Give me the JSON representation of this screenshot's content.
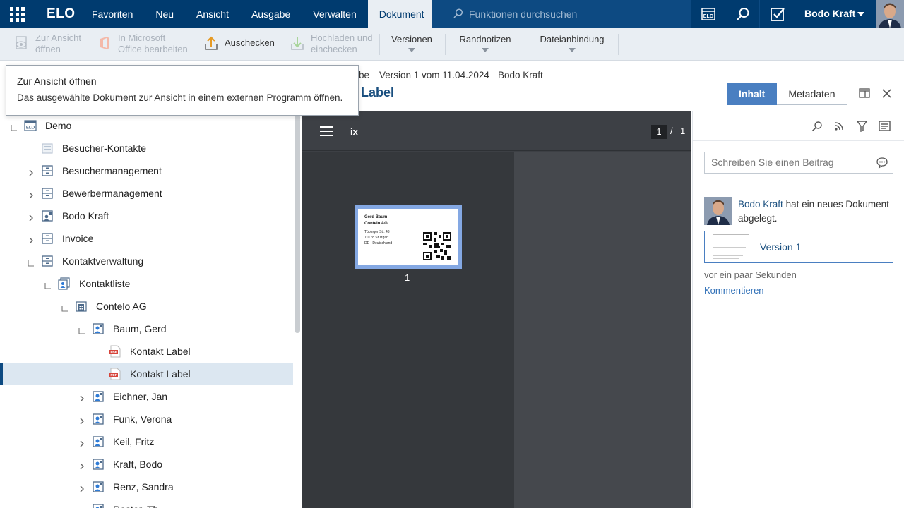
{
  "topbar": {
    "logo": "ELO",
    "nav": [
      "Favoriten",
      "Neu",
      "Ansicht",
      "Ausgabe",
      "Verwalten",
      "Dokument"
    ],
    "active_nav": "Dokument",
    "search_placeholder": "Funktionen durchsuchen",
    "user": "Bodo Kraft"
  },
  "ribbon": {
    "open_view": [
      "Zur Ansicht",
      "öffnen"
    ],
    "edit_office": [
      "In Microsoft",
      "Office bearbeiten"
    ],
    "checkout": "Auschecken",
    "upload": [
      "Hochladen und",
      "einchecken"
    ],
    "versions": "Versionen",
    "notes": "Randnotizen",
    "file_link": "Dateianbindung"
  },
  "tooltip": {
    "title": "Zur Ansicht öffnen",
    "text": "Das ausgewählte Dokument zur Ansicht in einem externen Programm öffnen."
  },
  "document": {
    "breadcrumb_tail": "be",
    "version": "Version 1 vom 11.04.2024",
    "author": "Bodo Kraft",
    "title": "Label",
    "tabs": [
      "Inhalt",
      "Metadaten"
    ],
    "active_tab": "Inhalt"
  },
  "tree": [
    {
      "label": "Demo",
      "level": 0,
      "state": "expanded",
      "icon": "archive-icon"
    },
    {
      "label": "Besucher-Kontakte",
      "level": 1,
      "state": "leaf",
      "icon": "folder-icon"
    },
    {
      "label": "Besuchermanagement",
      "level": 1,
      "state": "collapsed",
      "icon": "cabinet-icon"
    },
    {
      "label": "Bewerbermanagement",
      "level": 1,
      "state": "collapsed",
      "icon": "cabinet-icon"
    },
    {
      "label": "Bodo Kraft",
      "level": 1,
      "state": "collapsed",
      "icon": "user-folder-icon"
    },
    {
      "label": "Invoice",
      "level": 1,
      "state": "collapsed",
      "icon": "cabinet-icon"
    },
    {
      "label": "Kontaktverwaltung",
      "level": 1,
      "state": "expanded",
      "icon": "cabinet-icon"
    },
    {
      "label": "Kontaktliste",
      "level": 2,
      "state": "expanded",
      "icon": "contact-list-icon"
    },
    {
      "label": "Contelo AG",
      "level": 3,
      "state": "expanded",
      "icon": "company-icon"
    },
    {
      "label": "Baum, Gerd",
      "level": 4,
      "state": "expanded",
      "icon": "contact-icon"
    },
    {
      "label": "Kontakt Label",
      "level": 5,
      "state": "leaf",
      "icon": "pdf-icon"
    },
    {
      "label": "Kontakt Label",
      "level": 5,
      "state": "leaf",
      "icon": "pdf-icon",
      "selected": true
    },
    {
      "label": "Eichner, Jan",
      "level": 4,
      "state": "collapsed",
      "icon": "contact-icon"
    },
    {
      "label": "Funk, Verona",
      "level": 4,
      "state": "collapsed",
      "icon": "contact-icon"
    },
    {
      "label": "Keil, Fritz",
      "level": 4,
      "state": "collapsed",
      "icon": "contact-icon"
    },
    {
      "label": "Kraft, Bodo",
      "level": 4,
      "state": "collapsed",
      "icon": "contact-icon"
    },
    {
      "label": "Renz, Sandra",
      "level": 4,
      "state": "collapsed",
      "icon": "contact-icon"
    },
    {
      "label": "Roster, Th",
      "level": 4,
      "state": "collapsed",
      "icon": "contact-icon"
    }
  ],
  "viewer": {
    "filename": "ix",
    "page_current": "1",
    "page_sep": "/",
    "page_total": "1",
    "thumb_number": "1",
    "card_lines": [
      "Gerd Baum",
      "Contelo AG",
      "Tübinger Str. 43",
      "70178 Stuttgart",
      "DE - Deutschland"
    ]
  },
  "feed": {
    "placeholder": "Schreiben Sie einen Beitrag",
    "user": "Bodo Kraft",
    "message": "hat ein neues Dokument abgelegt.",
    "version_label": "Version 1",
    "time": "vor ein paar Sekunden",
    "comment": "Kommentieren"
  },
  "colors": {
    "topbar": "#003b6f",
    "accent": "#4a7fc1",
    "selection": "#dce7f1",
    "viewer_bg": "#3d4045"
  }
}
